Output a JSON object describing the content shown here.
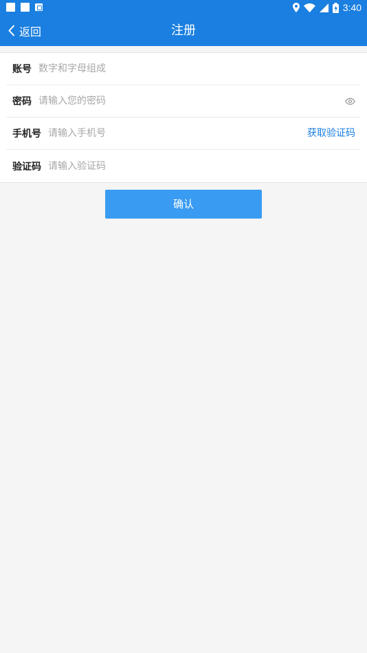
{
  "status_bar": {
    "time": "3:40",
    "icons": [
      "notification-square-icon",
      "notification-square-icon",
      "app-notification-icon",
      "location-icon",
      "wifi-icon",
      "cell-signal-icon",
      "battery-charging-icon"
    ]
  },
  "header": {
    "back_label": "返回",
    "title": "注册"
  },
  "form": {
    "account": {
      "label": "账号",
      "placeholder": "数字和字母组成",
      "value": ""
    },
    "password": {
      "label": "密码",
      "placeholder": "请输入您的密码",
      "value": ""
    },
    "phone": {
      "label": "手机号",
      "placeholder": "请输入手机号",
      "value": "",
      "get_code_label": "获取验证码"
    },
    "code": {
      "label": "验证码",
      "placeholder": "请输入验证码",
      "value": ""
    }
  },
  "confirm_label": "确认",
  "colors": {
    "primary": "#1a7fe0",
    "button": "#3a9bf2",
    "background": "#f5f5f5",
    "placeholder": "#a7a7a7"
  }
}
